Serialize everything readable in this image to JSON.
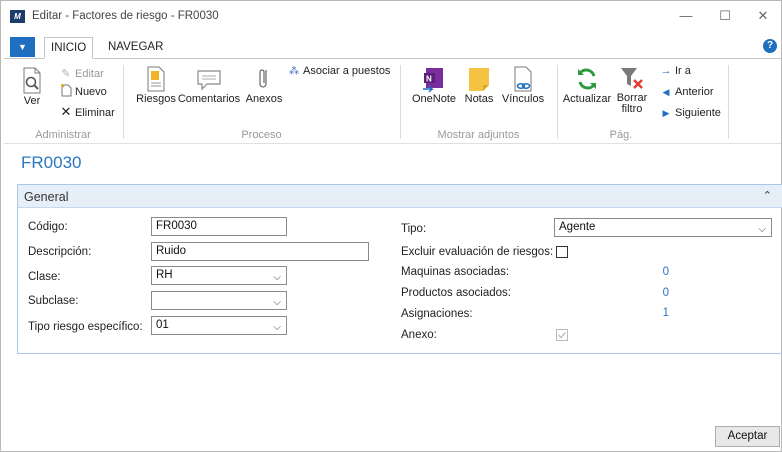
{
  "window": {
    "title": "Editar - Factores de riesgo - FR0030",
    "minimize": "—",
    "maximize": "☐",
    "close": "✕"
  },
  "ribbon": {
    "file_glyph": "▼",
    "tabs": [
      "INICIO",
      "NAVEGAR"
    ],
    "help": "?",
    "groups": {
      "administrar": {
        "label": "Administrar",
        "ver": "Ver",
        "editar": "Editar",
        "nuevo": "Nuevo",
        "eliminar": "Eliminar"
      },
      "proceso": {
        "label": "Proceso",
        "riesgos": "Riesgos",
        "comentarios": "Comentarios",
        "anexos": "Anexos",
        "asociar": "Asociar a puestos"
      },
      "adjuntos": {
        "label": "Mostrar adjuntos",
        "onenote": "OneNote",
        "notas": "Notas",
        "vinculos": "Vínculos"
      },
      "pag": {
        "label": "Pág.",
        "actualizar": "Actualizar",
        "borrar_line1": "Borrar",
        "borrar_line2": "filtro",
        "ira": "Ir a",
        "anterior": "Anterior",
        "siguiente": "Siguiente"
      }
    }
  },
  "record": {
    "title": "FR0030"
  },
  "general": {
    "title": "General",
    "fields": {
      "codigo": {
        "label": "Código:",
        "value": "FR0030"
      },
      "descripcion": {
        "label": "Descripción:",
        "value": "Ruido"
      },
      "clase": {
        "label": "Clase:",
        "value": "RH"
      },
      "subclase": {
        "label": "Subclase:",
        "value": ""
      },
      "tipo_riesgo": {
        "label": "Tipo riesgo específico:",
        "value": "01"
      },
      "tipo": {
        "label": "Tipo:",
        "value": "Agente"
      },
      "excluir": {
        "label": "Excluir evaluación de riesgos:",
        "checked": false
      },
      "maquinas": {
        "label": "Maquinas asociadas:",
        "value": "0"
      },
      "productos": {
        "label": "Productos asociados:",
        "value": "0"
      },
      "asignaciones": {
        "label": "Asignaciones:",
        "value": "1"
      },
      "anexo": {
        "label": "Anexo:",
        "checked": true
      }
    }
  },
  "footer": {
    "accept": "Aceptar"
  },
  "colors": {
    "accent": "#2b76c2",
    "file_tab": "#1e6fbf",
    "fasttab_header": "#e6eff8",
    "onenote": "#7a2d9c",
    "notes": "#f5c342",
    "refresh": "#2e9a3e"
  }
}
